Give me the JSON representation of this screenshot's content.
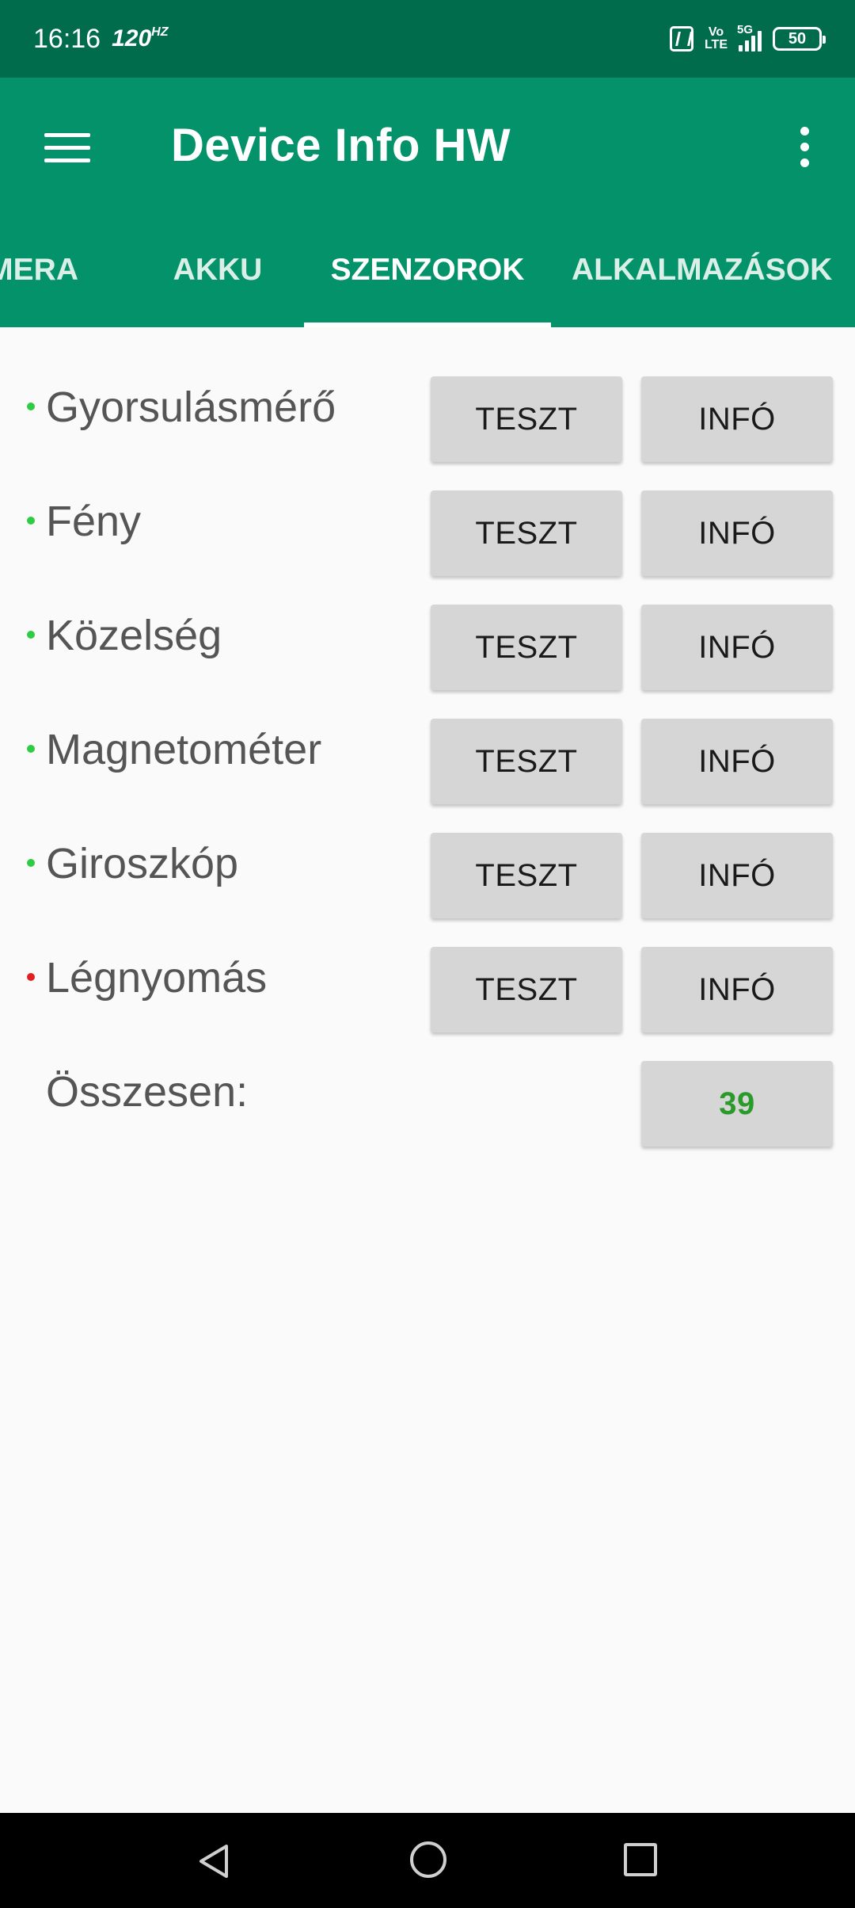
{
  "status_bar": {
    "time": "16:16",
    "refresh_rate": "120",
    "refresh_unit": "HZ",
    "network_label": "5G",
    "volte_top": "Vo",
    "volte_bottom": "LTE",
    "battery": "50"
  },
  "app_bar": {
    "title": "Device Info HW",
    "menu_icon": "hamburger-menu-icon",
    "more_icon": "overflow-menu-icon"
  },
  "tabs": [
    {
      "label": "KAMERA",
      "visible_text": "AMERA",
      "active": false
    },
    {
      "label": "AKKU",
      "active": false
    },
    {
      "label": "SZENZOROK",
      "active": true
    },
    {
      "label": "ALKALMAZÁSOK",
      "active": false
    }
  ],
  "sensors": [
    {
      "name": "Gyorsulásmérő",
      "status_color": "#2ecc40",
      "test_label": "TESZT",
      "info_label": "INFÓ"
    },
    {
      "name": "Fény",
      "status_color": "#2ecc40",
      "test_label": "TESZT",
      "info_label": "INFÓ"
    },
    {
      "name": "Közelség",
      "status_color": "#2ecc40",
      "test_label": "TESZT",
      "info_label": "INFÓ"
    },
    {
      "name": "Magnetométer",
      "status_color": "#2ecc40",
      "test_label": "TESZT",
      "info_label": "INFÓ"
    },
    {
      "name": "Giroszkóp",
      "status_color": "#2ecc40",
      "test_label": "TESZT",
      "info_label": "INFÓ"
    },
    {
      "name": "Légnyomás",
      "status_color": "#e02020",
      "test_label": "TESZT",
      "info_label": "INFÓ"
    }
  ],
  "total": {
    "label": "Összesen:",
    "value": "39",
    "value_color": "#2a9a2a"
  },
  "colors": {
    "status_bar": "#006c4c",
    "primary": "#039269",
    "background": "#fafafa",
    "button": "#d6d6d6"
  },
  "nav_bar": {
    "back_icon": "back-triangle-icon",
    "home_icon": "home-circle-icon",
    "recents_icon": "recents-square-icon"
  }
}
